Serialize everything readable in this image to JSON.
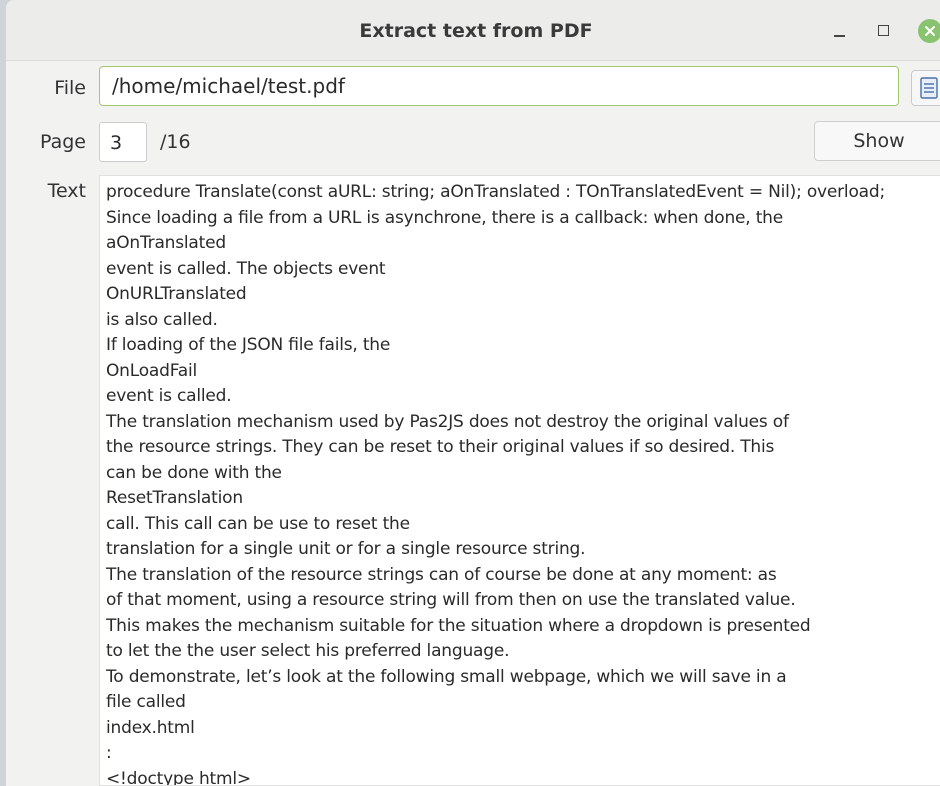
{
  "window": {
    "title": "Extract text from PDF"
  },
  "form": {
    "file_label": "File",
    "file_value": "/home/michael/test.pdf",
    "page_label": "Page",
    "page_value": "3",
    "page_total": "/16",
    "show_label": "Show",
    "text_label": "Text"
  },
  "text_lines": [
    "procedure Translate(const aURL: string; aOnTranslated : TOnTranslatedEvent = Nil); overload;",
    "Since loading a ﬁle from a URL is asynchrone, there is a callback: when done, the",
    "aOnTranslated",
    "event is called. The objects event",
    "OnURLTranslated",
    "is also called.",
    "If loading of the JSON ﬁle fails, the",
    "OnLoadFail",
    "event is called.",
    "The translation mechanism used by Pas2JS does not destroy the original values of",
    "the resource strings. They can be reset to their original values if so desired. This",
    "can be done with the",
    "ResetTranslation",
    "call. This call can be use to reset the",
    "translation for a single unit or for a single resource string.",
    "The translation of the resource strings can of course be done at any moment: as",
    "of that moment, using a resource string will from then on use the translated value.",
    "This makes the mechanism suitable for the situation where a dropdown is presented",
    "to let the the user select his preferred language.",
    "To demonstrate, let’s look at the following small webpage, which we will save in a",
    "ﬁle called",
    "index.html",
    ":",
    "<!doctype html>"
  ],
  "icons": {
    "minimize": "minimize-icon",
    "maximize": "maximize-icon",
    "close": "close-icon",
    "browse": "document-open-icon"
  },
  "colors": {
    "close_button": "#89c36f",
    "focus_border": "#a4c76f"
  }
}
